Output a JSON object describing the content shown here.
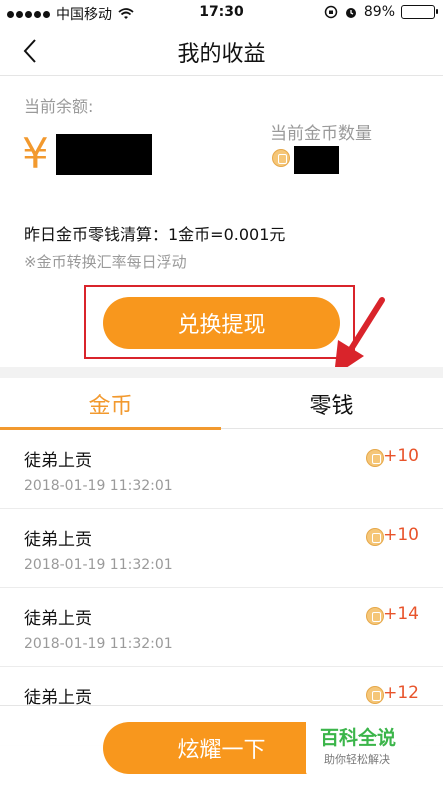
{
  "status_bar": {
    "carrier": "中国移动",
    "time": "17:30",
    "battery_percent": "89%",
    "battery_level": 0.89
  },
  "nav": {
    "title": "我的收益",
    "back_icon": "chevron-left-icon"
  },
  "balance": {
    "label": "当前余额:",
    "currency_symbol": "¥",
    "gold_label": "当前金币数量",
    "yesterday_text": "昨日金币零钱清算：1金币=0.001元",
    "rate_note": "※金币转换汇率每日浮动",
    "withdraw_label": "兑换提现"
  },
  "tabs": [
    {
      "label": "金币",
      "active": true
    },
    {
      "label": "零钱",
      "active": false
    }
  ],
  "records": [
    {
      "title": "徒弟上贡",
      "time": "2018-01-19 11:32:01",
      "amount": "+10"
    },
    {
      "title": "徒弟上贡",
      "time": "2018-01-19 11:32:01",
      "amount": "+10"
    },
    {
      "title": "徒弟上贡",
      "time": "2018-01-19 11:32:01",
      "amount": "+14"
    },
    {
      "title": "徒弟上贡",
      "time": "",
      "amount": "+12"
    }
  ],
  "bottom": {
    "share_label": "炫耀一下"
  },
  "watermark": {
    "title": "百科全说",
    "subtitle": "助你轻松解决"
  },
  "colors": {
    "accent": "#f8971d",
    "amount": "#e8542b",
    "highlight": "#d9242b",
    "watermark": "#3bb54a"
  }
}
